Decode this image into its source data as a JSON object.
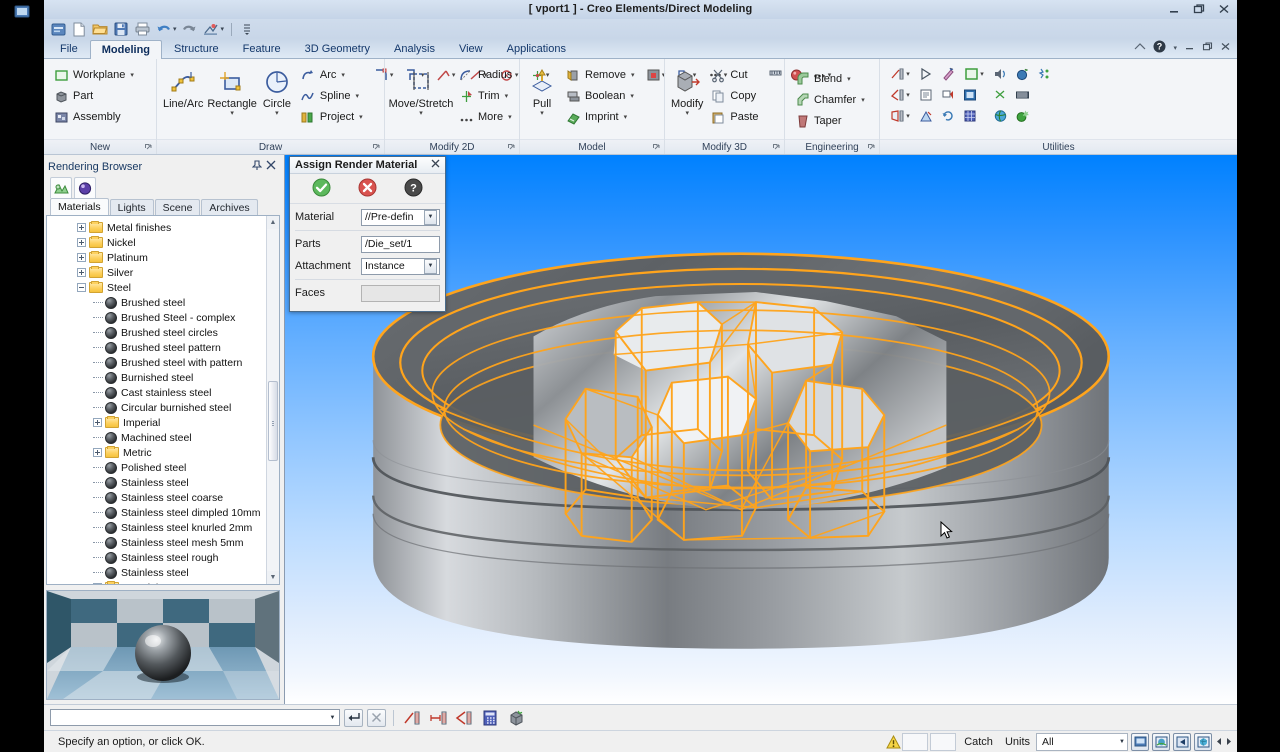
{
  "window": {
    "title": "[ vport1 ] - Creo Elements/Direct Modeling",
    "minimize_label": "Minimize",
    "restore_label": "Restore",
    "close_label": "Close"
  },
  "quick_access": {
    "items": [
      {
        "name": "app-menu-icon",
        "label": "Application Menu"
      },
      {
        "name": "new-icon",
        "label": "New"
      },
      {
        "name": "open-icon",
        "label": "Open"
      },
      {
        "name": "save-icon",
        "label": "Save"
      },
      {
        "name": "print-icon",
        "label": "Print"
      },
      {
        "name": "undo-icon",
        "label": "Undo"
      },
      {
        "name": "redo-icon",
        "label": "Redo"
      },
      {
        "name": "view-icon",
        "label": "View Tools"
      },
      {
        "name": "customize-icon",
        "label": "Customize Quick Access Toolbar"
      }
    ]
  },
  "ribbon": {
    "tabs": [
      {
        "label": "File",
        "active": false
      },
      {
        "label": "Modeling",
        "active": true
      },
      {
        "label": "Structure",
        "active": false
      },
      {
        "label": "Feature",
        "active": false
      },
      {
        "label": "3D Geometry",
        "active": false
      },
      {
        "label": "Analysis",
        "active": false
      },
      {
        "label": "View",
        "active": false
      },
      {
        "label": "Applications",
        "active": false
      }
    ],
    "help_label": "Help",
    "groups": {
      "new": {
        "label": "New",
        "items": [
          {
            "label": "Workplane",
            "caret": true
          },
          {
            "label": "Part",
            "caret": false
          },
          {
            "label": "Assembly",
            "caret": false
          }
        ]
      },
      "draw": {
        "label": "Draw",
        "big": [
          {
            "label": "Line/Arc",
            "caret": false
          },
          {
            "label": "Rectangle",
            "caret": true
          },
          {
            "label": "Circle",
            "caret": true
          }
        ],
        "small": [
          {
            "label": "Arc",
            "caret": true
          },
          {
            "label": "Spline",
            "caret": true
          },
          {
            "label": "Project",
            "caret": true
          }
        ]
      },
      "modify2d": {
        "label": "Modify 2D",
        "big": [
          {
            "label": "Move/Stretch",
            "caret": true
          }
        ],
        "small": [
          {
            "label": "Radius",
            "caret": false
          },
          {
            "label": "Trim",
            "caret": true
          },
          {
            "label": "More",
            "caret": true
          }
        ]
      },
      "model": {
        "label": "Model",
        "big": [
          {
            "label": "Pull",
            "caret": true
          }
        ],
        "small": [
          {
            "label": "Remove",
            "caret": true
          },
          {
            "label": "Boolean",
            "caret": true
          },
          {
            "label": "Imprint",
            "caret": true
          }
        ]
      },
      "modify3d": {
        "label": "Modify 3D",
        "big": [
          {
            "label": "Modify",
            "caret": true
          }
        ],
        "small": [
          {
            "label": "Cut",
            "caret": false
          },
          {
            "label": "Copy",
            "caret": false
          },
          {
            "label": "Paste",
            "caret": false
          }
        ]
      },
      "engineering": {
        "label": "Engineering",
        "small": [
          {
            "label": "Blend",
            "caret": true
          },
          {
            "label": "Chamfer",
            "caret": true
          },
          {
            "label": "Taper",
            "caret": false
          }
        ]
      },
      "utilities": {
        "label": "Utilities",
        "icons": [
          "measure-distance-icon",
          "select-arrow-icon",
          "highlight-icon",
          "workplane-square-icon",
          "audio-icon",
          "globe-blue-icon",
          "scatter-icon",
          "measure-angle-icon",
          "list-icon",
          "annotate-icon",
          "image-frame-icon",
          "scissors-icon",
          "film-icon",
          "measure-area-icon",
          "probe-icon",
          "refresh-view-icon",
          "grid-icon",
          "render-globe-icon",
          "render-wand-icon"
        ]
      }
    }
  },
  "browser": {
    "title": "Rendering Browser",
    "pin_label": "Auto Hide",
    "close_label": "Close",
    "tab_icons": [
      {
        "name": "materials-browser-icon",
        "label": "Materials Browser"
      },
      {
        "name": "render-sphere-icon",
        "label": "Render Preview"
      }
    ],
    "tabs": [
      {
        "label": "Materials",
        "active": true
      },
      {
        "label": "Lights",
        "active": false
      },
      {
        "label": "Scene",
        "active": false
      },
      {
        "label": "Archives",
        "active": false
      }
    ],
    "tree": [
      {
        "label": "Metal finishes",
        "type": "folder",
        "state": "collapsed",
        "indent": 1
      },
      {
        "label": "Nickel",
        "type": "folder",
        "state": "collapsed",
        "indent": 1
      },
      {
        "label": "Platinum",
        "type": "folder",
        "state": "collapsed",
        "indent": 1
      },
      {
        "label": "Silver",
        "type": "folder",
        "state": "collapsed",
        "indent": 1
      },
      {
        "label": "Steel",
        "type": "folder",
        "state": "expanded",
        "indent": 1
      },
      {
        "label": "Brushed steel",
        "type": "material",
        "indent": 2
      },
      {
        "label": "Brushed Steel - complex",
        "type": "material",
        "indent": 2
      },
      {
        "label": "Brushed steel circles",
        "type": "material",
        "indent": 2
      },
      {
        "label": "Brushed steel pattern",
        "type": "material",
        "indent": 2
      },
      {
        "label": "Brushed steel with pattern",
        "type": "material",
        "indent": 2
      },
      {
        "label": "Burnished steel",
        "type": "material",
        "indent": 2
      },
      {
        "label": "Cast stainless steel",
        "type": "material",
        "indent": 2
      },
      {
        "label": "Circular burnished steel",
        "type": "material",
        "indent": 2
      },
      {
        "label": "Imperial",
        "type": "folder",
        "state": "collapsed",
        "indent": 2
      },
      {
        "label": "Machined steel",
        "type": "material",
        "indent": 2
      },
      {
        "label": "Metric",
        "type": "folder",
        "state": "collapsed",
        "indent": 2
      },
      {
        "label": "Polished steel",
        "type": "material",
        "indent": 2
      },
      {
        "label": "Stainless steel",
        "type": "material",
        "indent": 2
      },
      {
        "label": "Stainless steel coarse",
        "type": "material",
        "indent": 2
      },
      {
        "label": "Stainless steel dimpled 10mm",
        "type": "material",
        "indent": 2
      },
      {
        "label": "Stainless steel knurled 2mm",
        "type": "material",
        "indent": 2
      },
      {
        "label": "Stainless steel mesh 5mm",
        "type": "material",
        "indent": 2
      },
      {
        "label": "Stainless steel rough",
        "type": "material",
        "indent": 2
      },
      {
        "label": "Stainless steel",
        "type": "material",
        "indent": 2
      },
      {
        "label": "Treadplate",
        "type": "folder",
        "state": "collapsed",
        "indent": 2
      }
    ],
    "preview_label": "Material preview sphere"
  },
  "dialog": {
    "title": "Assign Render Material",
    "close_label": "Close",
    "buttons": [
      {
        "name": "ok-button",
        "label": "OK",
        "color": "#4caf3f"
      },
      {
        "name": "cancel-button",
        "label": "Cancel",
        "color": "#d9453d"
      },
      {
        "name": "help-button",
        "label": "Help",
        "color": "#4a4a4a"
      }
    ],
    "fields": [
      {
        "name": "material-field",
        "label": "Material",
        "value": "//Pre-defin",
        "type": "dropdown"
      },
      {
        "name": "parts-field",
        "label": "Parts",
        "value": "/Die_set/1",
        "type": "text"
      },
      {
        "name": "attachment-field",
        "label": "Attachment",
        "value": "Instance",
        "type": "dropdown"
      },
      {
        "name": "faces-field",
        "label": "Faces",
        "value": "",
        "type": "text-disabled"
      }
    ]
  },
  "viewport": {
    "name": "3d-model-viewport",
    "model_label": "Die set cylindrical assembly",
    "background_top": "#0081ff",
    "background_bottom": "#ffffff",
    "wireframe_color": "#ff9d1c",
    "body_color": "#9a9ea2"
  },
  "command_bar": {
    "input_value": "",
    "input_placeholder": "",
    "buttons": [
      {
        "name": "enter-button",
        "label": "Enter"
      },
      {
        "name": "cancel-command-button",
        "label": "Cancel"
      },
      {
        "name": "measure-distance-icon",
        "label": "Measure Distance"
      },
      {
        "name": "measure-length-icon",
        "label": "Measure Length"
      },
      {
        "name": "measure-angle-icon",
        "label": "Measure Angle"
      },
      {
        "name": "calculator-icon",
        "label": "Calculator"
      },
      {
        "name": "render-box-icon",
        "label": "Render"
      }
    ]
  },
  "status_bar": {
    "message": "Specify an option, or click OK.",
    "warning_label": "Warnings",
    "catch_label": "Catch",
    "units_label": "Units",
    "units_value": "All",
    "icons": [
      {
        "name": "viewport-display-icon",
        "label": "Viewport Display"
      },
      {
        "name": "shade-view-icon",
        "label": "Shaded View"
      },
      {
        "name": "previous-view-icon",
        "label": "Previous View"
      },
      {
        "name": "render-view-icon",
        "label": "Render View"
      },
      {
        "name": "pan-arrows-icon",
        "label": "Pan"
      }
    ]
  }
}
